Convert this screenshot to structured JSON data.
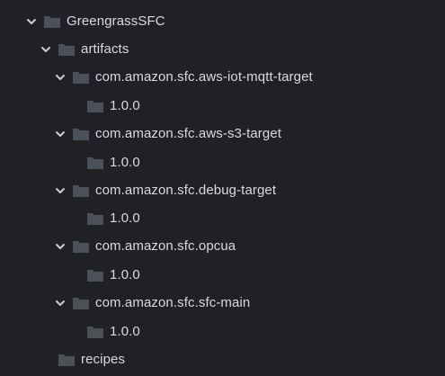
{
  "tree": {
    "clipped_label": "",
    "items": [
      {
        "label": "GreengrassSFC",
        "type": "folder",
        "expanded": true,
        "depth": 0,
        "icon": "folder-icon",
        "chevron": "chevron-down-icon"
      },
      {
        "label": "artifacts",
        "type": "folder",
        "expanded": true,
        "depth": 1,
        "icon": "folder-icon",
        "chevron": "chevron-down-icon"
      },
      {
        "label": "com.amazon.sfc.aws-iot-mqtt-target",
        "type": "folder",
        "expanded": true,
        "depth": 2,
        "icon": "folder-icon",
        "chevron": "chevron-down-icon"
      },
      {
        "label": "1.0.0",
        "type": "folder",
        "expanded": false,
        "depth": 3,
        "icon": "folder-icon"
      },
      {
        "label": "com.amazon.sfc.aws-s3-target",
        "type": "folder",
        "expanded": true,
        "depth": 2,
        "icon": "folder-icon",
        "chevron": "chevron-down-icon"
      },
      {
        "label": "1.0.0",
        "type": "folder",
        "expanded": false,
        "depth": 3,
        "icon": "folder-icon"
      },
      {
        "label": "com.amazon.sfc.debug-target",
        "type": "folder",
        "expanded": true,
        "depth": 2,
        "icon": "folder-icon",
        "chevron": "chevron-down-icon"
      },
      {
        "label": "1.0.0",
        "type": "folder",
        "expanded": false,
        "depth": 3,
        "icon": "folder-icon"
      },
      {
        "label": "com.amazon.sfc.opcua",
        "type": "folder",
        "expanded": true,
        "depth": 2,
        "icon": "folder-icon",
        "chevron": "chevron-down-icon"
      },
      {
        "label": "1.0.0",
        "type": "folder",
        "expanded": false,
        "depth": 3,
        "icon": "folder-icon"
      },
      {
        "label": "com.amazon.sfc.sfc-main",
        "type": "folder",
        "expanded": true,
        "depth": 2,
        "icon": "folder-icon",
        "chevron": "chevron-down-icon"
      },
      {
        "label": "1.0.0",
        "type": "folder",
        "expanded": false,
        "depth": 3,
        "icon": "folder-icon"
      },
      {
        "label": "recipes",
        "type": "folder",
        "expanded": false,
        "depth": 1,
        "icon": "folder-icon"
      }
    ]
  },
  "colors": {
    "background": "#202124",
    "text": "#d7dbe0",
    "folder": "#4b5159",
    "chevron": "#c9ced6"
  }
}
